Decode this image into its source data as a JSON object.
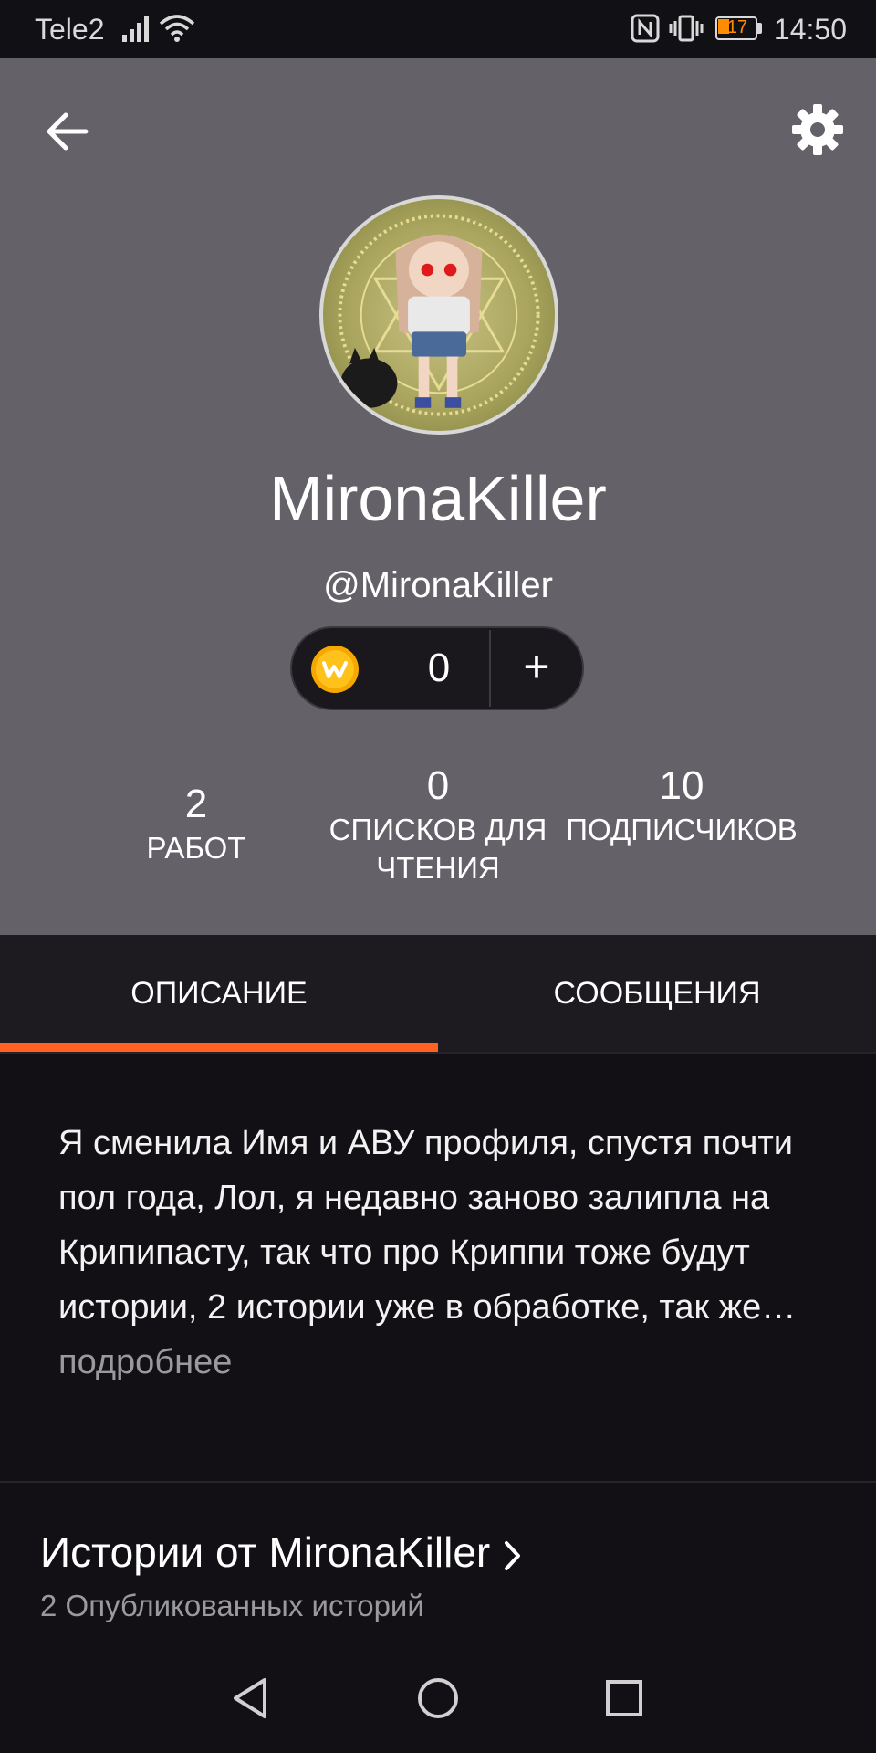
{
  "status_bar": {
    "carrier": "Tele2",
    "time": "14:50",
    "battery_level": "17",
    "icons": [
      "signal-icon",
      "wifi-icon",
      "nfc-icon",
      "vibrate-icon",
      "battery-icon"
    ]
  },
  "header": {
    "icons": [
      "back-arrow-icon",
      "gear-icon"
    ],
    "display_name": "MironaKiller",
    "handle": "@MironaKiller",
    "coins": {
      "count": "0",
      "add_label": "+",
      "icon": "wattpad-coin-icon"
    },
    "stats": [
      {
        "value": "2",
        "label": "РАБОТ"
      },
      {
        "value": "0",
        "label": "СПИСКОВ ДЛЯ ЧТЕНИЯ"
      },
      {
        "value": "10",
        "label": "ПОДПИСЧИКОВ"
      }
    ]
  },
  "tabs": {
    "description": "ОПИСАНИЕ",
    "messages": "СООБЩЕНИЯ",
    "active": "description"
  },
  "about": {
    "text": "Я сменила Имя и АВУ профиля, спустя почти пол года, Лол, я недавно заново залипла на Крипипасту, так что про Криппи тоже будут истории, 2 истории уже в обработке, так же…",
    "more": " подробнее"
  },
  "stories": {
    "title": "Истории от MironaKiller",
    "subtitle": "2 Опубликованных историй"
  },
  "colors": {
    "accent": "#ff6122",
    "header_bg": "#646268",
    "tab_bg": "#1d1b20",
    "page_bg": "#121014"
  }
}
